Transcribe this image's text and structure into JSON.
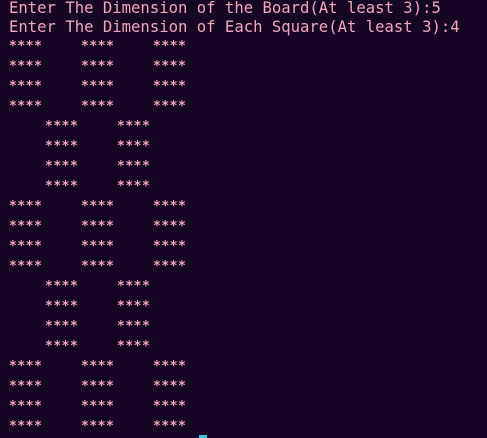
{
  "terminal": {
    "prompts": [
      {
        "text": "Enter The Dimension of the Board(At least 3):",
        "answer": "5"
      },
      {
        "text": "Enter The Dimension of Each Square(At least 3):",
        "answer": "4"
      }
    ],
    "cell_text": "****",
    "board_rows": [
      {
        "type": "full"
      },
      {
        "type": "full"
      },
      {
        "type": "full"
      },
      {
        "type": "full"
      },
      {
        "type": "offset"
      },
      {
        "type": "offset"
      },
      {
        "type": "offset"
      },
      {
        "type": "offset"
      },
      {
        "type": "full"
      },
      {
        "type": "full"
      },
      {
        "type": "full"
      },
      {
        "type": "full"
      },
      {
        "type": "offset"
      },
      {
        "type": "offset"
      },
      {
        "type": "offset"
      },
      {
        "type": "offset"
      },
      {
        "type": "full"
      },
      {
        "type": "full"
      },
      {
        "type": "full"
      },
      {
        "type": "full"
      }
    ],
    "text_color": "#f3a6bd",
    "background_color": "#160524",
    "cursor_color": "#36c3d9"
  }
}
